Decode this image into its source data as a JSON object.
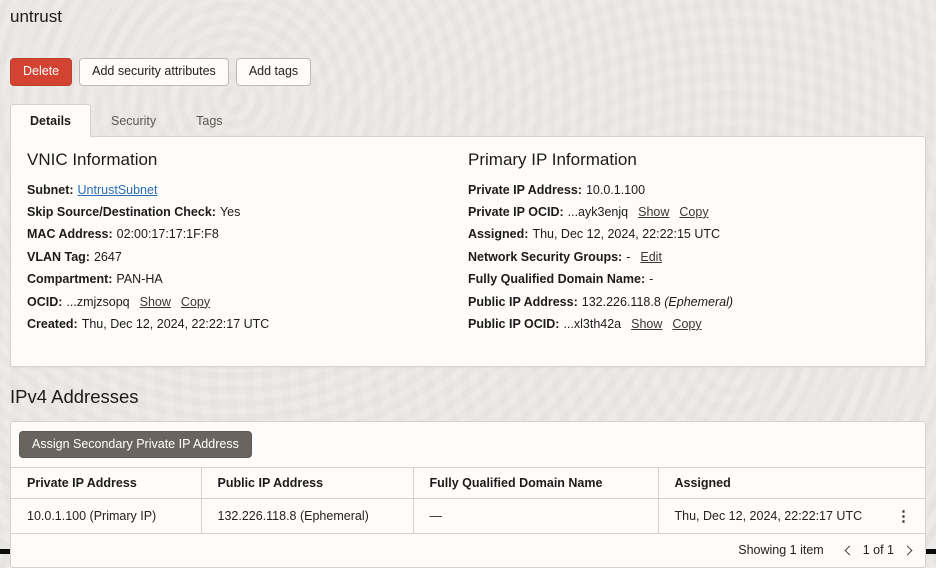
{
  "page": {
    "title": "untrust"
  },
  "actions": {
    "delete_label": "Delete",
    "add_security_attributes_label": "Add security attributes",
    "add_tags_label": "Add tags"
  },
  "tabs": {
    "details": "Details",
    "security": "Security",
    "tags": "Tags"
  },
  "vnic": {
    "heading": "VNIC Information",
    "fields": [
      {
        "label": "Subnet:",
        "link": "UntrustSubnet"
      },
      {
        "label": "Skip Source/Destination Check:",
        "value": "Yes"
      },
      {
        "label": "MAC Address:",
        "value": "02:00:17:17:1F:F8"
      },
      {
        "label": "VLAN Tag:",
        "value": "2647"
      },
      {
        "label": "Compartment:",
        "value": "PAN-HA"
      },
      {
        "label": "OCID:",
        "value": "...zmjzsopq",
        "links": [
          "Show",
          "Copy"
        ]
      },
      {
        "label": "Created:",
        "value": "Thu, Dec 12, 2024, 22:22:17 UTC"
      }
    ]
  },
  "primary_ip": {
    "heading": "Primary IP Information",
    "fields": [
      {
        "label": "Private IP Address:",
        "value": "10.0.1.100"
      },
      {
        "label": "Private IP OCID:",
        "value": "...ayk3enjq",
        "links": [
          "Show",
          "Copy"
        ]
      },
      {
        "label": "Assigned:",
        "value": "Thu, Dec 12, 2024, 22:22:15 UTC"
      },
      {
        "label": "Network Security Groups:",
        "value": "-",
        "links": [
          "Edit"
        ]
      },
      {
        "label": "Fully Qualified Domain Name:",
        "value": "-"
      },
      {
        "label": "Public IP Address:",
        "value": "132.226.118.8",
        "suffix": "(Ephemeral)"
      },
      {
        "label": "Public IP OCID:",
        "value": "...xl3th42a",
        "links": [
          "Show",
          "Copy"
        ]
      }
    ]
  },
  "ipv4": {
    "heading": "IPv4 Addresses",
    "assign_button_label": "Assign Secondary Private IP Address",
    "table": {
      "columns": [
        "Private IP Address",
        "Public IP Address",
        "Fully Qualified Domain Name",
        "Assigned"
      ],
      "rows": [
        [
          "10.0.1.100 (Primary IP)",
          "132.226.118.8 (Ephemeral)",
          "—",
          "Thu, Dec 12, 2024, 22:22:17 UTC"
        ]
      ],
      "row_menu_icon": "⋮"
    },
    "footer": {
      "showing_text": "Showing 1 item",
      "page_indicator": "1 of 1"
    }
  },
  "colors": {
    "danger_red": "#d24331",
    "dark_button": "#6a645f",
    "link_blue": "#2a6db2",
    "page_background": "#ebe9e5",
    "card_background": "#fdfcfb",
    "border": "#d5d2ce"
  }
}
